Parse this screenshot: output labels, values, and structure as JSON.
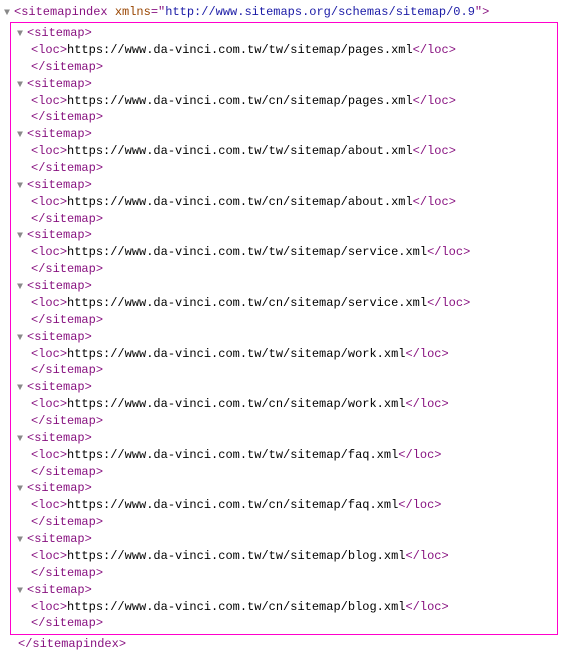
{
  "root": {
    "tag": "sitemapindex",
    "attrName": "xmlns",
    "attrValue": "http://www.sitemaps.org/schemas/sitemap/0.9",
    "closeTag": "sitemapindex"
  },
  "childTag": "sitemap",
  "locTag": "loc",
  "sitemaps": [
    {
      "url": "https://www.da-vinci.com.tw/tw/sitemap/pages.xml"
    },
    {
      "url": "https://www.da-vinci.com.tw/cn/sitemap/pages.xml"
    },
    {
      "url": "https://www.da-vinci.com.tw/tw/sitemap/about.xml"
    },
    {
      "url": "https://www.da-vinci.com.tw/cn/sitemap/about.xml"
    },
    {
      "url": "https://www.da-vinci.com.tw/tw/sitemap/service.xml"
    },
    {
      "url": "https://www.da-vinci.com.tw/cn/sitemap/service.xml"
    },
    {
      "url": "https://www.da-vinci.com.tw/tw/sitemap/work.xml"
    },
    {
      "url": "https://www.da-vinci.com.tw/cn/sitemap/work.xml"
    },
    {
      "url": "https://www.da-vinci.com.tw/tw/sitemap/faq.xml"
    },
    {
      "url": "https://www.da-vinci.com.tw/cn/sitemap/faq.xml"
    },
    {
      "url": "https://www.da-vinci.com.tw/tw/sitemap/blog.xml"
    },
    {
      "url": "https://www.da-vinci.com.tw/cn/sitemap/blog.xml"
    }
  ]
}
